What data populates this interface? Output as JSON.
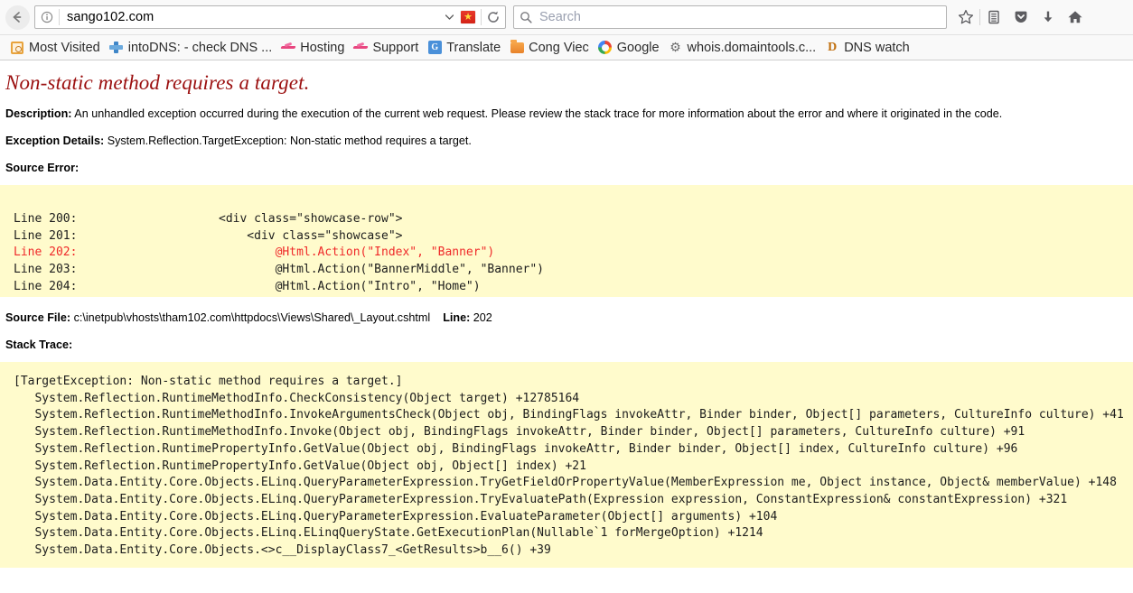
{
  "browser": {
    "back_icon": "back-arrow-icon",
    "url": "sango102.com",
    "url_dropdown_icon": "chevron-down-icon",
    "identity_icon": "info-circle-icon",
    "flag_icon": "vietnam-flag-icon",
    "reload_icon": "reload-icon",
    "search": {
      "placeholder": "Search",
      "icon": "search-icon"
    },
    "toolbar_icons": [
      {
        "name": "bookmark-star-icon",
        "glyph": "☆"
      },
      {
        "name": "library-icon",
        "glyph": "὜8"
      },
      {
        "name": "pocket-icon",
        "glyph": "pocket"
      },
      {
        "name": "downloads-icon",
        "glyph": "↓"
      },
      {
        "name": "home-icon",
        "glyph": "⌂"
      }
    ],
    "bookmarks": [
      {
        "label": "Most Visited",
        "icon": "most-visited-icon"
      },
      {
        "label": "intoDNS: - check DNS ...",
        "icon": "intodns-icon"
      },
      {
        "label": "Hosting",
        "icon": "hosting-plane-icon"
      },
      {
        "label": "Support",
        "icon": "support-plane-icon"
      },
      {
        "label": "Translate",
        "icon": "google-translate-icon"
      },
      {
        "label": "Cong Viec",
        "icon": "folder-icon"
      },
      {
        "label": "Google",
        "icon": "google-icon"
      },
      {
        "label": "whois.domaintools.c...",
        "icon": "gear-icon"
      },
      {
        "label": "DNS watch",
        "icon": "dns-watch-icon"
      }
    ]
  },
  "error_page": {
    "title": "Non-static method requires a target.",
    "description_label": "Description:",
    "description_text": "An unhandled exception occurred during the execution of the current web request. Please review the stack trace for more information about the error and where it originated in the code.",
    "exception_label": "Exception Details:",
    "exception_text": "System.Reflection.TargetException: Non-static method requires a target.",
    "source_error_label": "Source Error:",
    "source_lines": [
      {
        "num": "Line 200:",
        "code": "                    <div class=\"showcase-row\">",
        "highlight": false
      },
      {
        "num": "Line 201:",
        "code": "                        <div class=\"showcase\">",
        "highlight": false
      },
      {
        "num": "Line 202:",
        "code": "                            @Html.Action(\"Index\", \"Banner\")",
        "highlight": true
      },
      {
        "num": "Line 203:",
        "code": "                            @Html.Action(\"BannerMiddle\", \"Banner\")",
        "highlight": false
      },
      {
        "num": "Line 204:",
        "code": "                            @Html.Action(\"Intro\", \"Home\")",
        "highlight": false
      }
    ],
    "source_file_label": "Source File:",
    "source_file_value": "c:\\inetpub\\vhosts\\tham102.com\\httpdocs\\Views\\Shared\\_Layout.cshtml",
    "line_label": "Line:",
    "line_value": "202",
    "stack_trace_label": "Stack Trace:",
    "stack_trace_lines": [
      "[TargetException: Non-static method requires a target.]",
      "   System.Reflection.RuntimeMethodInfo.CheckConsistency(Object target) +12785164",
      "   System.Reflection.RuntimeMethodInfo.InvokeArgumentsCheck(Object obj, BindingFlags invokeAttr, Binder binder, Object[] parameters, CultureInfo culture) +41",
      "   System.Reflection.RuntimeMethodInfo.Invoke(Object obj, BindingFlags invokeAttr, Binder binder, Object[] parameters, CultureInfo culture) +91",
      "   System.Reflection.RuntimePropertyInfo.GetValue(Object obj, BindingFlags invokeAttr, Binder binder, Object[] index, CultureInfo culture) +96",
      "   System.Reflection.RuntimePropertyInfo.GetValue(Object obj, Object[] index) +21",
      "   System.Data.Entity.Core.Objects.ELinq.QueryParameterExpression.TryGetFieldOrPropertyValue(MemberExpression me, Object instance, Object& memberValue) +148",
      "   System.Data.Entity.Core.Objects.ELinq.QueryParameterExpression.TryEvaluatePath(Expression expression, ConstantExpression& constantExpression) +321",
      "   System.Data.Entity.Core.Objects.ELinq.QueryParameterExpression.EvaluateParameter(Object[] arguments) +104",
      "   System.Data.Entity.Core.Objects.ELinq.ELinqQueryState.GetExecutionPlan(Nullable`1 forMergeOption) +1214",
      "   System.Data.Entity.Core.Objects.<>c__DisplayClass7_<GetResults>b__6() +39"
    ]
  }
}
